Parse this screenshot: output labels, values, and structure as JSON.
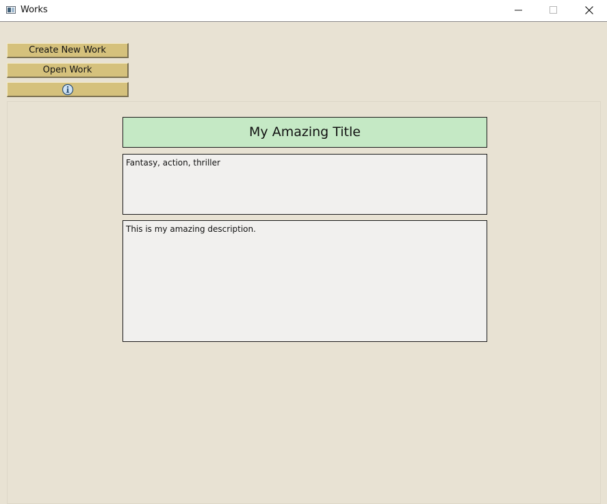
{
  "window": {
    "title": "Works",
    "controls": [
      "minimize",
      "maximize",
      "close"
    ]
  },
  "toolbar": {
    "create_label": "Create New Work",
    "open_label": "Open Work",
    "info_icon": "info-icon"
  },
  "work": {
    "title": "My Amazing Title",
    "genres": "Fantasy, action, thriller",
    "description": "This is my amazing description."
  },
  "colors": {
    "background": "#e8e2d3",
    "button": "#d5c17c",
    "title_box": "#c5e9c5",
    "text_box": "#f1f0ee"
  }
}
